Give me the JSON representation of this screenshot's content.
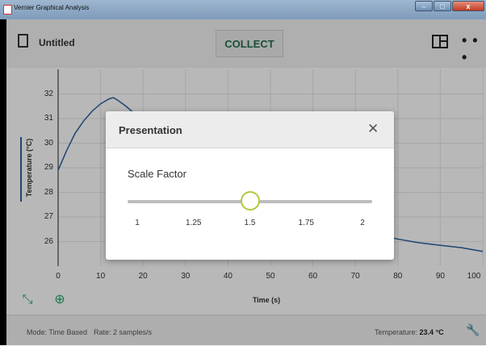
{
  "window": {
    "title": "Vernier Graphical Analysis",
    "minimize": "–",
    "maximize": "□",
    "close": "x"
  },
  "toolbar": {
    "doc_title": "Untitled",
    "collect_label": "COLLECT",
    "doc_icon": "document-icon",
    "layout_icon": "page-layout-icon",
    "more_icon": "more-options-icon",
    "more_glyph": "• • •"
  },
  "graph": {
    "y_label": "Temperature (°C)",
    "x_label": "Time (s)",
    "y_ticks": [
      "32",
      "31",
      "30",
      "29",
      "28",
      "27",
      "26"
    ],
    "x_ticks": [
      "0",
      "10",
      "20",
      "30",
      "40",
      "50",
      "60",
      "70",
      "80",
      "90",
      "100"
    ],
    "line_color": "#2a5fa0"
  },
  "chart_data": {
    "type": "line",
    "xlabel": "Time (s)",
    "ylabel": "Temperature (°C)",
    "xlim": [
      0,
      100
    ],
    "ylim": [
      25,
      33
    ],
    "series": [
      {
        "x": [
          0,
          2,
          4,
          6,
          8,
          10,
          12,
          13,
          14,
          16,
          18,
          20,
          72,
          76,
          80,
          85,
          90,
          95,
          100
        ],
        "y": [
          28.9,
          29.7,
          30.4,
          30.9,
          31.3,
          31.6,
          31.8,
          31.85,
          31.75,
          31.5,
          31.2,
          30.9,
          26.4,
          26.25,
          26.1,
          25.95,
          25.85,
          25.75,
          25.6
        ]
      }
    ]
  },
  "graph_tools": {
    "autoscale_icon": "autoscale-icon",
    "zoom_icon": "zoom-icon",
    "autoscale_glyph": "⤡",
    "zoom_glyph": "⊕"
  },
  "status": {
    "mode": "Mode: Time Based",
    "rate": "Rate: 2 samples/s",
    "temp_label": "Temperature:",
    "temp_value": "23.4 °C",
    "wrench_icon": "wrench-icon",
    "wrench_glyph": "🔧"
  },
  "dialog": {
    "title": "Presentation",
    "close_glyph": "✕",
    "scale_label": "Scale Factor",
    "slider_ticks": [
      "1",
      "1.25",
      "1.5",
      "1.75",
      "2"
    ],
    "slider_value": 1.5,
    "accent": "#b0c83c"
  }
}
